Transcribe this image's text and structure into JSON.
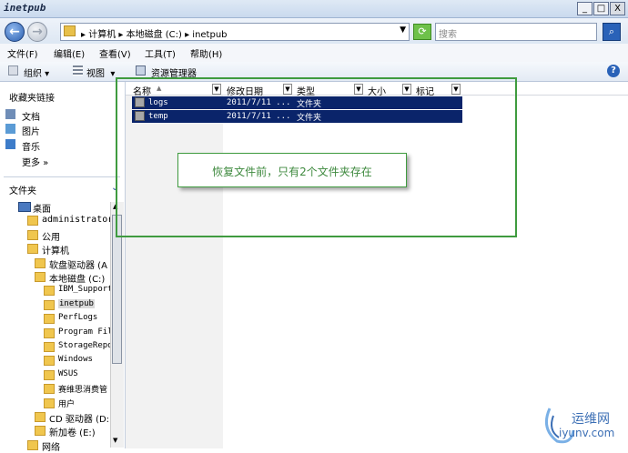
{
  "window": {
    "title": "inetpub",
    "minimize": "_",
    "maximize": "□",
    "close": "X"
  },
  "address": {
    "path": "▸ 计算机 ▸ 本地磁盘 (C:) ▸ inetpub",
    "search_placeholder": "搜索"
  },
  "menu": [
    "文件(F)",
    "编辑(E)",
    "查看(V)",
    "工具(T)",
    "帮助(H)"
  ],
  "toolbar": {
    "organize": "组织",
    "views": "视图",
    "explorer": "资源管理器"
  },
  "nav": {
    "favorites_title": "收藏夹链接",
    "favorites": [
      "文档",
      "图片",
      "音乐"
    ],
    "more": "更多 »",
    "folders_title": "文件夹",
    "tree": [
      {
        "label": "桌面",
        "level": 0
      },
      {
        "label": "administrator",
        "level": 1
      },
      {
        "label": "公用",
        "level": 1
      },
      {
        "label": "计算机",
        "level": 1
      },
      {
        "label": "软盘驱动器 (A",
        "level": 2
      },
      {
        "label": "本地磁盘 (C:)",
        "level": 2
      },
      {
        "label": "IBM_Support",
        "level": 3
      },
      {
        "label": "inetpub",
        "level": 3
      },
      {
        "label": "PerfLogs",
        "level": 3
      },
      {
        "label": "Program File",
        "level": 3
      },
      {
        "label": "StorageRepor",
        "level": 3
      },
      {
        "label": "Windows",
        "level": 3
      },
      {
        "label": "WSUS",
        "level": 3
      },
      {
        "label": "赛维思消费管",
        "level": 3
      },
      {
        "label": "用户",
        "level": 3
      },
      {
        "label": "CD 驱动器 (D:",
        "level": 2
      },
      {
        "label": "新加卷 (E:)",
        "level": 2
      },
      {
        "label": "网络",
        "level": 1
      }
    ]
  },
  "columns": [
    "名称",
    "修改日期",
    "类型",
    "大小",
    "标记"
  ],
  "files": [
    {
      "name": "logs",
      "date": "2011/7/11 ...",
      "type": "文件夹"
    },
    {
      "name": "temp",
      "date": "2011/7/11 ...",
      "type": "文件夹"
    }
  ],
  "callout": "恢复文件前，只有2个文件夹存在",
  "watermark": {
    "line1": "运维网",
    "line2": "iyunv.com"
  }
}
